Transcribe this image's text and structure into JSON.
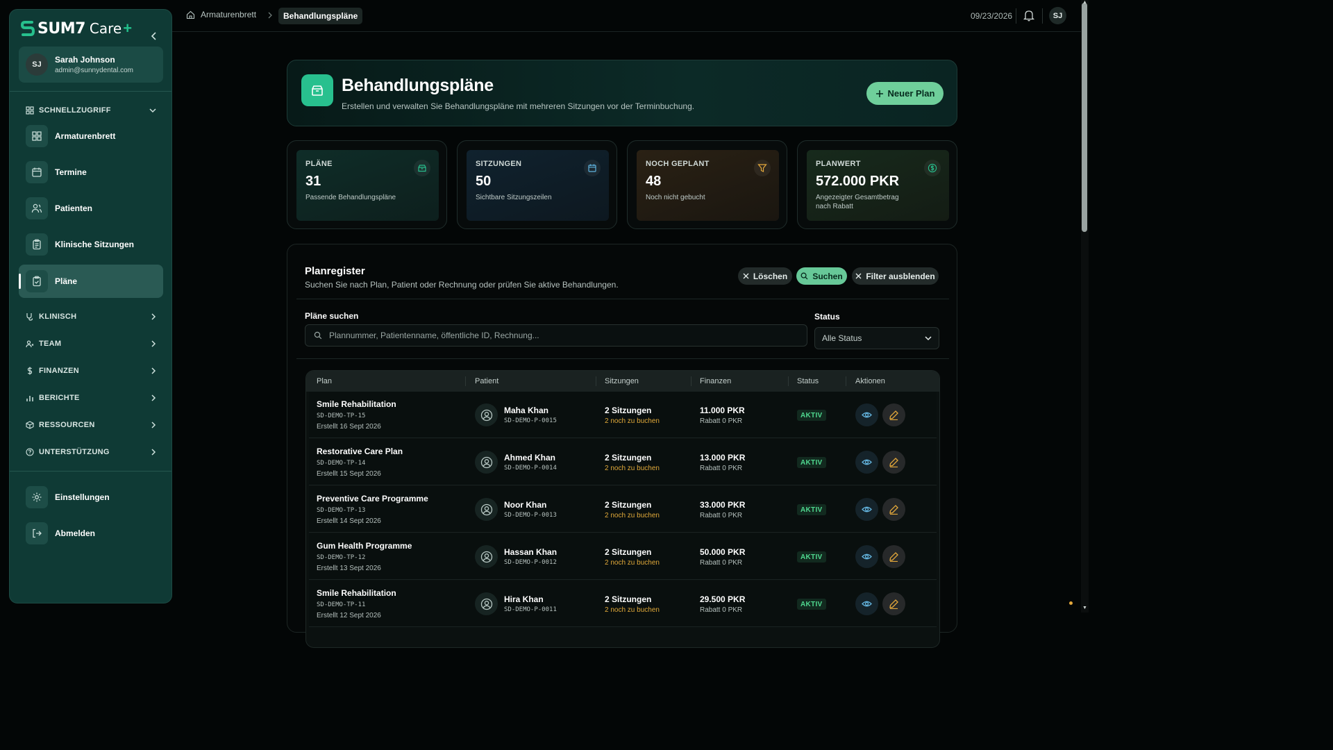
{
  "brand": {
    "name": "SUM7",
    "product": "Care",
    "plus": "+"
  },
  "user": {
    "initials": "SJ",
    "name": "Sarah Johnson",
    "email": "admin@sunnydental.com"
  },
  "sidebar": {
    "quick_access": "SCHNELLZUGRIFF",
    "items": [
      {
        "label": "Armaturenbrett",
        "icon": "dashboard-icon"
      },
      {
        "label": "Termine",
        "icon": "calendar-icon"
      },
      {
        "label": "Patienten",
        "icon": "users-icon"
      },
      {
        "label": "Klinische Sitzungen",
        "icon": "clipboard-icon"
      },
      {
        "label": "Pläne",
        "icon": "clipboard-check-icon",
        "active": true
      }
    ],
    "sections": [
      {
        "label": "KLINISCH",
        "icon": "stethoscope-icon"
      },
      {
        "label": "TEAM",
        "icon": "team-icon"
      },
      {
        "label": "FINANZEN",
        "icon": "dollar-icon"
      },
      {
        "label": "BERICHTE",
        "icon": "bar-chart-icon"
      },
      {
        "label": "RESSOURCEN",
        "icon": "box-icon"
      },
      {
        "label": "UNTERSTÜTZUNG",
        "icon": "help-icon"
      }
    ],
    "bottom": [
      {
        "label": "Einstellungen",
        "icon": "gear-icon"
      },
      {
        "label": "Abmelden",
        "icon": "logout-icon"
      }
    ]
  },
  "topbar": {
    "home": "Armaturenbrett",
    "current": "Behandlungspläne",
    "date": "09/23/2026",
    "avatar": "SJ"
  },
  "hero": {
    "title": "Behandlungspläne",
    "subtitle": "Erstellen und verwalten Sie Behandlungspläne mit mehreren Sitzungen vor der Terminbuchung.",
    "new_button": "Neuer Plan"
  },
  "stats": [
    {
      "label": "PLÄNE",
      "value": "31",
      "desc": "Passende Behandlungspläne",
      "icon": "box-icon",
      "color": "#28c08e"
    },
    {
      "label": "SITZUNGEN",
      "value": "50",
      "desc": "Sichtbare Sitzungszeilen",
      "icon": "calendar-icon",
      "color": "#5fb4e0"
    },
    {
      "label": "NOCH GEPLANT",
      "value": "48",
      "desc": "Noch nicht gebucht",
      "icon": "filter-icon",
      "color": "#e3a83b"
    },
    {
      "label": "PLANWERT",
      "value": "572.000 PKR",
      "desc": "Angezeigter Gesamtbetrag nach Rabatt",
      "icon": "dollar-circle-icon",
      "color": "#28c08e"
    }
  ],
  "register": {
    "title": "Planregister",
    "subtitle": "Suchen Sie nach Plan, Patient oder Rechnung oder prüfen Sie aktive Behandlungen.",
    "clear_button": "Löschen",
    "search_button": "Suchen",
    "hide_filters_button": "Filter ausblenden",
    "search_label": "Pläne suchen",
    "search_placeholder": "Plannummer, Patientenname, öffentliche ID, Rechnung...",
    "status_label": "Status",
    "status_value": "Alle Status"
  },
  "table": {
    "columns": [
      "Plan",
      "Patient",
      "Sitzungen",
      "Finanzen",
      "Status",
      "Aktionen"
    ],
    "rows": [
      {
        "plan": "Smile Rehabilitation",
        "plan_id": "SD-DEMO-TP-15",
        "created": "Erstellt 16 Sept 2026",
        "patient": "Maha Khan",
        "patient_id": "SD-DEMO-P-0015",
        "sessions": "2 Sitzungen",
        "to_book": "2 noch zu buchen",
        "amount": "11.000 PKR",
        "discount": "Rabatt 0 PKR",
        "status": "AKTIV"
      },
      {
        "plan": "Restorative Care Plan",
        "plan_id": "SD-DEMO-TP-14",
        "created": "Erstellt 15 Sept 2026",
        "patient": "Ahmed Khan",
        "patient_id": "SD-DEMO-P-0014",
        "sessions": "2 Sitzungen",
        "to_book": "2 noch zu buchen",
        "amount": "13.000 PKR",
        "discount": "Rabatt 0 PKR",
        "status": "AKTIV"
      },
      {
        "plan": "Preventive Care Programme",
        "plan_id": "SD-DEMO-TP-13",
        "created": "Erstellt 14 Sept 2026",
        "patient": "Noor Khan",
        "patient_id": "SD-DEMO-P-0013",
        "sessions": "2 Sitzungen",
        "to_book": "2 noch zu buchen",
        "amount": "33.000 PKR",
        "discount": "Rabatt 0 PKR",
        "status": "AKTIV"
      },
      {
        "plan": "Gum Health Programme",
        "plan_id": "SD-DEMO-TP-12",
        "created": "Erstellt 13 Sept 2026",
        "patient": "Hassan Khan",
        "patient_id": "SD-DEMO-P-0012",
        "sessions": "2 Sitzungen",
        "to_book": "2 noch zu buchen",
        "amount": "50.000 PKR",
        "discount": "Rabatt 0 PKR",
        "status": "AKTIV"
      },
      {
        "plan": "Smile Rehabilitation",
        "plan_id": "SD-DEMO-TP-11",
        "created": "Erstellt 12 Sept 2026",
        "patient": "Hira Khan",
        "patient_id": "SD-DEMO-P-0011",
        "sessions": "2 Sitzungen",
        "to_book": "2 noch zu buchen",
        "amount": "29.500 PKR",
        "discount": "Rabatt 0 PKR",
        "status": "AKTIV"
      }
    ]
  }
}
